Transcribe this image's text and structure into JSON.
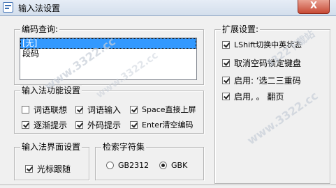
{
  "window": {
    "title": "输入法设置",
    "close_label": "X"
  },
  "encoding_query": {
    "label": "编码查询:",
    "items": [
      {
        "label": "[无]",
        "selected": true
      },
      {
        "label": "段码",
        "selected": false
      }
    ]
  },
  "ime_functions": {
    "label": "输入法功能设置",
    "options": [
      {
        "label": "词语联想",
        "checked": false
      },
      {
        "label": "词语输入",
        "checked": true
      },
      {
        "label": "Space直接上屏",
        "checked": true
      },
      {
        "label": "逐渐提示",
        "checked": true
      },
      {
        "label": "外码提示",
        "checked": true
      },
      {
        "label": "Enter清空编码",
        "checked": true
      }
    ]
  },
  "ime_ui": {
    "label": "输入法界面设置",
    "options": [
      {
        "label": "光标跟随",
        "checked": true
      }
    ]
  },
  "charset": {
    "label": "检索字符集",
    "options": [
      {
        "label": "GB2312",
        "selected": false
      },
      {
        "label": "GBK",
        "selected": true
      }
    ]
  },
  "extended": {
    "label": "扩展设置:",
    "options": [
      {
        "label": "LShift切换中英状态",
        "checked": true
      },
      {
        "label": "取消空码锁定键盘",
        "checked": true
      },
      {
        "label": "启用: ‘选二三重码",
        "checked": true
      },
      {
        "label": "启用, 。 翻页",
        "checked": true
      }
    ]
  },
  "watermarks": [
    "www.3322.cc",
    "3322下载站",
    "www.3322.cc",
    "www.3322.cc"
  ]
}
